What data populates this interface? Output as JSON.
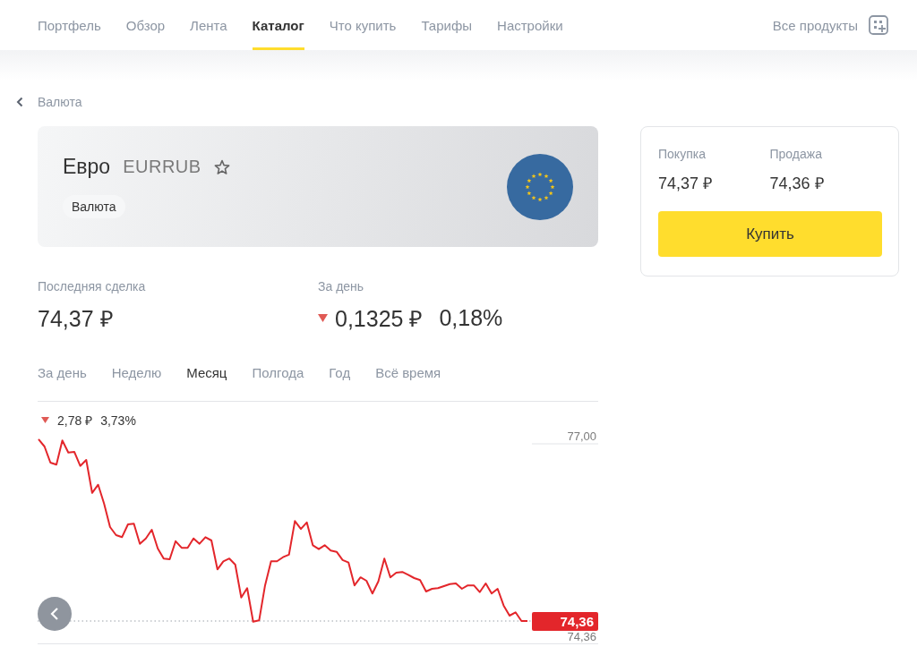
{
  "nav": {
    "tabs": [
      {
        "label": "Портфель",
        "selected": false
      },
      {
        "label": "Обзор",
        "selected": false
      },
      {
        "label": "Лента",
        "selected": false
      },
      {
        "label": "Каталог",
        "selected": true
      },
      {
        "label": "Что купить",
        "selected": false
      },
      {
        "label": "Тарифы",
        "selected": false
      },
      {
        "label": "Настройки",
        "selected": false
      }
    ],
    "all_products": "Все продукты"
  },
  "breadcrumb": "Валюта",
  "instrument": {
    "name": "Евро",
    "ticker": "EURRUB",
    "favorite": false,
    "tag": "Валюта"
  },
  "trade": {
    "buy_label": "Покупка",
    "buy_price": "74,37 ₽",
    "sell_label": "Продажа",
    "sell_price": "74,36 ₽",
    "button": "Купить"
  },
  "stats": {
    "last_label": "Последняя сделка",
    "last_value": "74,37 ₽",
    "day_label": "За день",
    "day_falling": true,
    "day_change": "0,1325 ₽",
    "day_pct": "0,18%"
  },
  "periods": [
    {
      "label": "За день",
      "selected": false
    },
    {
      "label": "Неделю",
      "selected": false
    },
    {
      "label": "Месяц",
      "selected": true
    },
    {
      "label": "Полгода",
      "selected": false
    },
    {
      "label": "Год",
      "selected": false
    },
    {
      "label": "Всё время",
      "selected": false
    }
  ],
  "chart": {
    "falling": true,
    "change": "2,78 ₽",
    "change_pct": "3,73%",
    "max_label": "77,00",
    "price_tag": "74,36",
    "min_label": "74,36"
  }
}
